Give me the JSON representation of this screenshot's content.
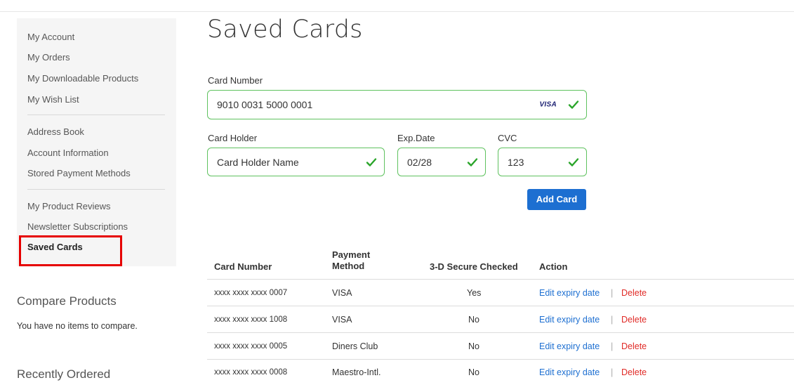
{
  "sidebar": {
    "group1": [
      "My Account",
      "My Orders",
      "My Downloadable Products",
      "My Wish List"
    ],
    "group2": [
      "Address Book",
      "Account Information",
      "Stored Payment Methods"
    ],
    "group3": [
      "My Product Reviews",
      "Newsletter Subscriptions"
    ],
    "active": "Saved Cards"
  },
  "compare": {
    "title": "Compare Products",
    "empty_text": "You have no items to compare."
  },
  "recently_ordered": {
    "title": "Recently Ordered"
  },
  "page": {
    "title": "Saved Cards"
  },
  "form": {
    "card_number_label": "Card Number",
    "card_number_value": "9010 0031 5000 0001",
    "card_brand": "VISA",
    "card_holder_label": "Card Holder",
    "card_holder_value": "Card Holder Name",
    "exp_label": "Exp.Date",
    "exp_value": "02/28",
    "cvc_label": "CVC",
    "cvc_value": "123",
    "add_button": "Add Card",
    "valid_color": "#2aa52a"
  },
  "table": {
    "headers": [
      "Card Number",
      "Payment Method",
      "3-D Secure Checked",
      "Action"
    ],
    "header_payment_line1": "Payment",
    "header_payment_line2": "Method",
    "rows": [
      {
        "card": "xxxx xxxx xxxx 0007",
        "method": "VISA",
        "secure": "Yes"
      },
      {
        "card": "xxxx xxxx xxxx 1008",
        "method": "VISA",
        "secure": "No"
      },
      {
        "card": "xxxx xxxx xxxx 0005",
        "method": "Diners Club",
        "secure": "No"
      },
      {
        "card": "xxxx xxxx xxxx 0008",
        "method": "Maestro-Intl.",
        "secure": "No"
      }
    ],
    "edit_label": "Edit expiry date",
    "separator": "|",
    "delete_label": "Delete"
  }
}
